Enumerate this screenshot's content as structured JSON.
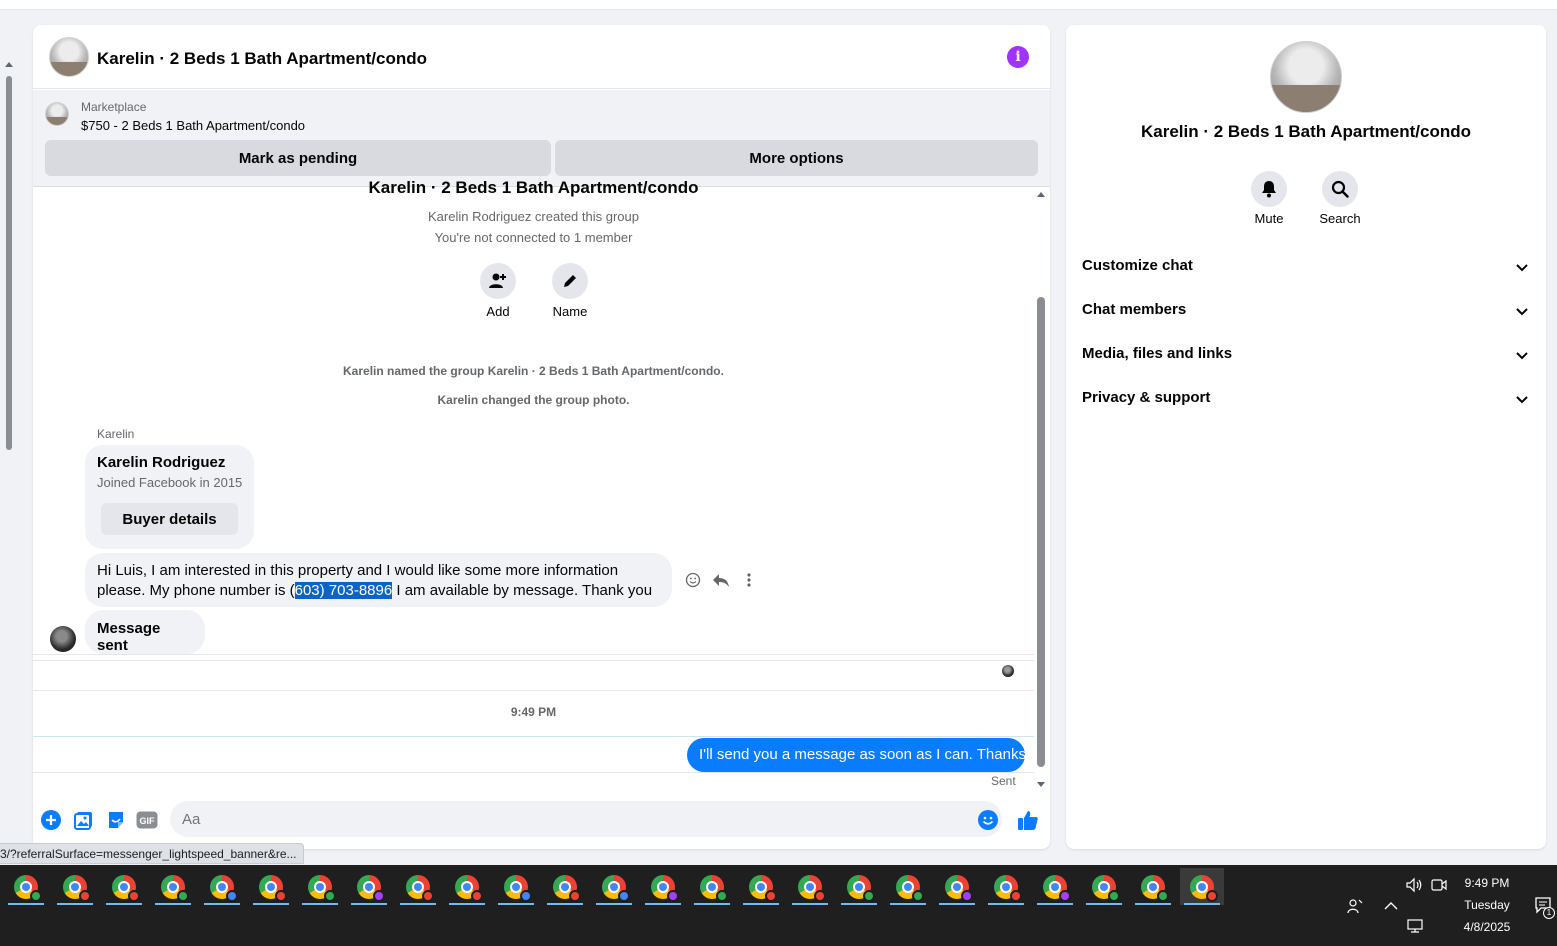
{
  "chat": {
    "title": "Karelin · 2 Beds 1 Bath Apartment/condo",
    "marketplace": {
      "label": "Marketplace",
      "listing": "$750 - 2 Beds 1 Bath Apartment/condo",
      "pending_button": "Mark as pending",
      "more_button": "More options"
    },
    "intro": {
      "title": "Karelin · 2 Beds 1 Bath Apartment/condo",
      "created": "Karelin Rodriguez created this group",
      "connection": "You're not connected to 1 member",
      "add_label": "Add",
      "name_label": "Name"
    },
    "events": [
      "Karelin named the group Karelin · 2 Beds 1 Bath Apartment/condo.",
      "Karelin changed the group photo."
    ],
    "sender_name": "Karelin",
    "buyer_card": {
      "name": "Karelin Rodriguez",
      "joined": "Joined Facebook in 2015",
      "button": "Buyer details"
    },
    "incoming_message": {
      "before": "Hi Luis, I am interested in this property and I would like some more information please. My phone number is (",
      "highlighted": "603) 703-8896",
      "after": " I am available by message. Thank you"
    },
    "message_sent_label": "Message sent",
    "timestamp": "9:49 PM",
    "outgoing_message": "I'll send you a message as soon as I can. Thanks",
    "outgoing_status": "Sent",
    "composer": {
      "placeholder": "Aa",
      "gif_label": "GIF"
    }
  },
  "side_panel": {
    "title": "Karelin · 2 Beds 1 Bath Apartment/condo",
    "mute_label": "Mute",
    "search_label": "Search",
    "sections": [
      "Customize chat",
      "Chat members",
      "Media, files and links",
      "Privacy & support"
    ]
  },
  "status_bar": {
    "url_fragment": "3/?referralSurface=messenger_lightspeed_banner&re..."
  },
  "taskbar": {
    "time": "9:49 PM",
    "day": "Tuesday",
    "date": "4/8/2025",
    "notification_count": "1",
    "app_count": 25
  },
  "colors": {
    "accent": "#0a7cff",
    "info": "#a033ff",
    "highlight": "#0a64c8"
  }
}
